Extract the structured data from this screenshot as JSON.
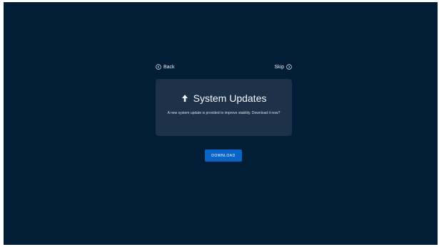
{
  "nav": {
    "back_label": "Back",
    "back_icon": "chevron-left-circle-icon",
    "skip_label": "Skip",
    "skip_icon": "chevron-right-circle-icon"
  },
  "card": {
    "title": "System Updates",
    "title_icon": "arrow-up-icon",
    "description": "A new system update is provided to improve stability. Download it now?"
  },
  "actions": {
    "download_label": "DOWNLOAD"
  },
  "colors": {
    "background": "#021d36",
    "card": "#1d3149",
    "accent": "#0964c8",
    "text": "#f4f7fb"
  }
}
